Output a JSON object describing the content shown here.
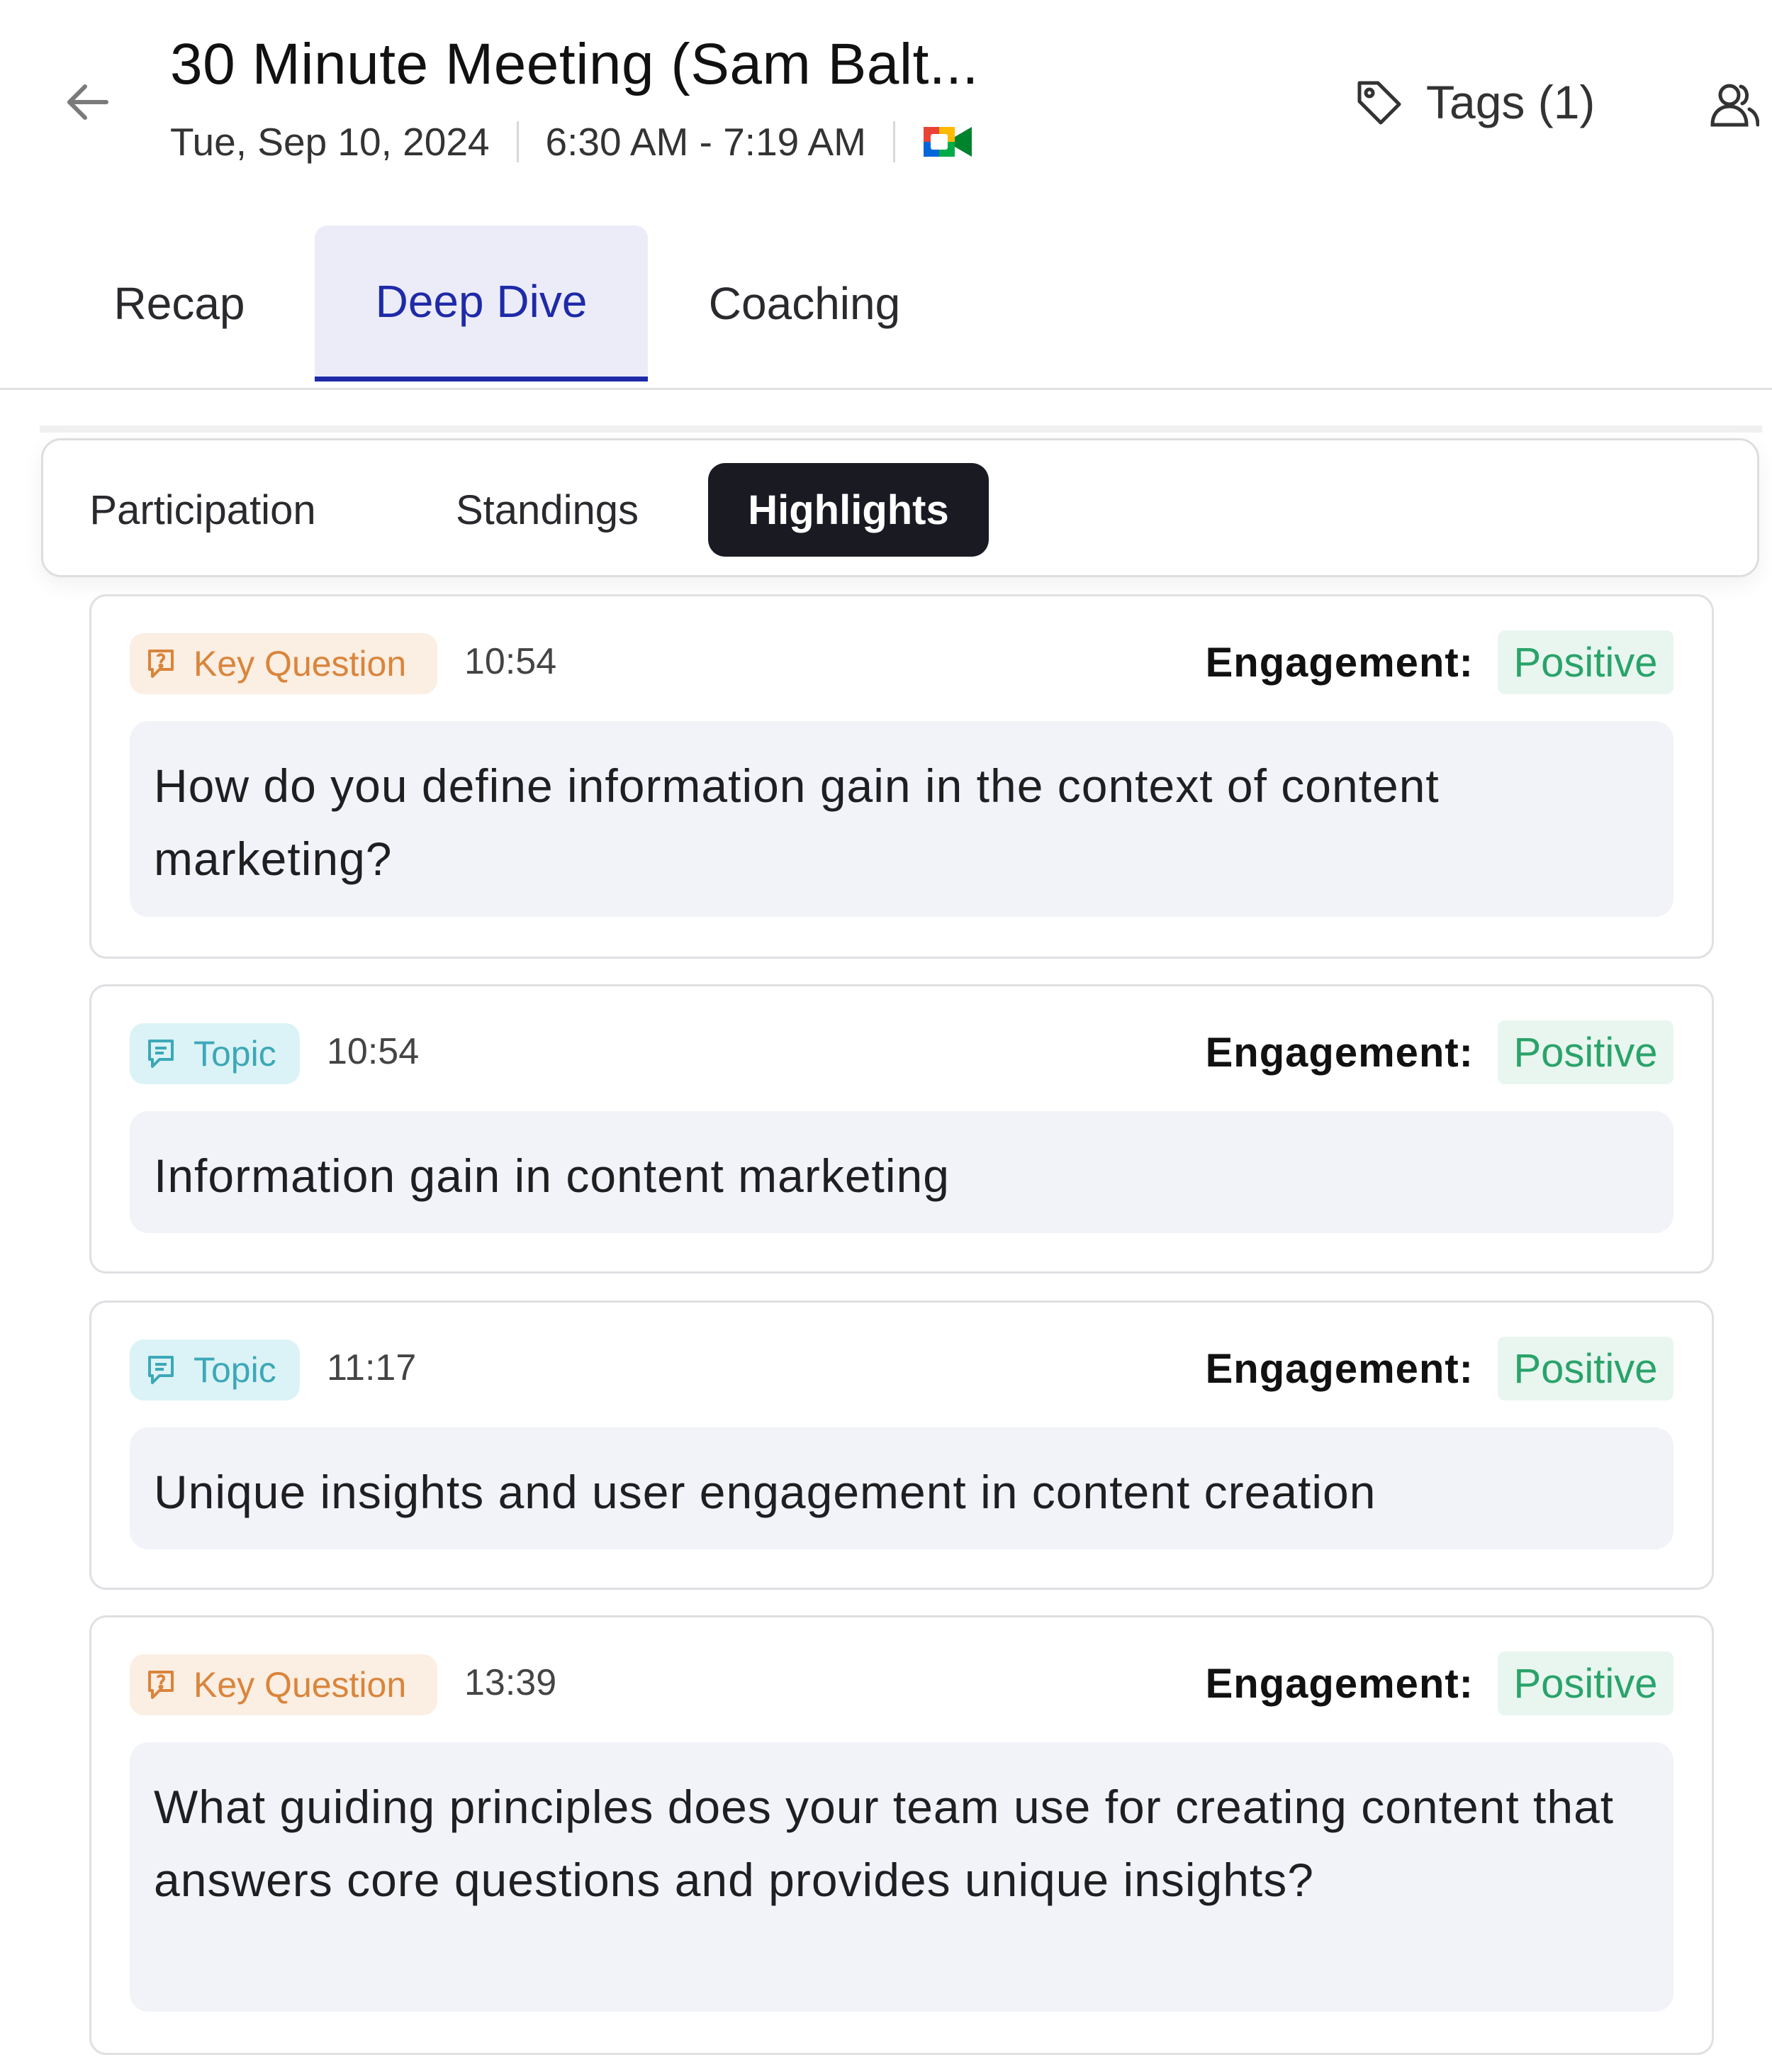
{
  "header": {
    "title": "30 Minute Meeting (Sam Balt...",
    "date": "Tue, Sep 10, 2024",
    "time_range": "6:30 AM - 7:19 AM",
    "tags_label": "Tags (1)"
  },
  "main_tabs": [
    {
      "label": "Recap",
      "active": false
    },
    {
      "label": "Deep Dive",
      "active": true
    },
    {
      "label": "Coaching",
      "active": false
    }
  ],
  "sub_tabs": [
    {
      "label": "Participation",
      "active": false
    },
    {
      "label": "Standings",
      "active": false
    },
    {
      "label": "Highlights",
      "active": true
    }
  ],
  "engagement_label": "Engagement:",
  "highlights": [
    {
      "type": "Key Question",
      "time": "10:54",
      "engagement": "Positive",
      "text": "How do you define information gain in the context of content marketing?"
    },
    {
      "type": "Topic",
      "time": "10:54",
      "engagement": "Positive",
      "text": "Information gain in content marketing"
    },
    {
      "type": "Topic",
      "time": "11:17",
      "engagement": "Positive",
      "text": "Unique insights and user engagement in content creation"
    },
    {
      "type": "Key Question",
      "time": "13:39",
      "engagement": "Positive",
      "text": "What guiding principles does your team use for creating content that answers core questions and provides unique insights?"
    }
  ],
  "colors": {
    "accent": "#1f2aa8",
    "accent_bg": "#ebecf8",
    "key_question": "#d9853c",
    "topic": "#3da8b8",
    "positive": "#2aa36a"
  }
}
